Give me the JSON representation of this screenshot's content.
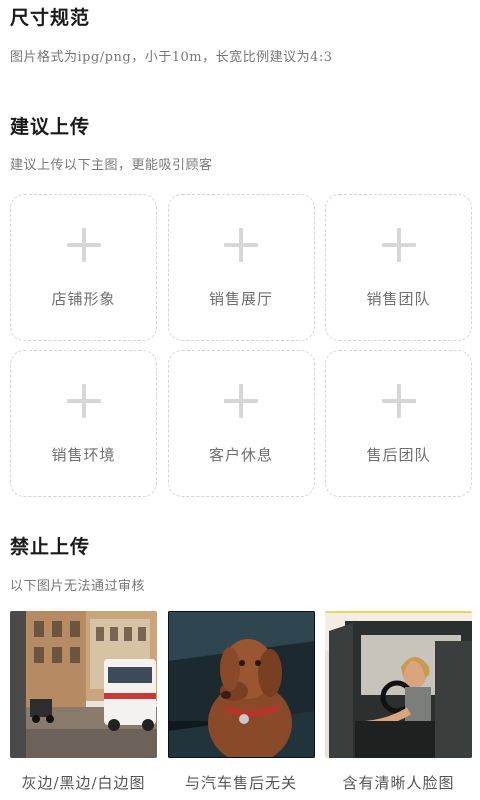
{
  "size_spec": {
    "title": "尺寸规范",
    "desc": "图片格式为ipg/png，小于10m，长宽比例建议为4:3"
  },
  "suggest": {
    "title": "建议上传",
    "desc": "建议上传以下主图，更能吸引顾客",
    "slots": [
      {
        "label": "店铺形象"
      },
      {
        "label": "销售展厅"
      },
      {
        "label": "销售团队"
      },
      {
        "label": "销售环境"
      },
      {
        "label": "客户休息"
      },
      {
        "label": "售后团队"
      }
    ]
  },
  "forbid": {
    "title": "禁止上传",
    "desc": "以下图片无法通过审核",
    "items": [
      {
        "label": "灰边/黑边/白边图",
        "image": "street-van-photo"
      },
      {
        "label": "与汽车售后无关",
        "image": "dog-in-car-photo"
      },
      {
        "label": "含有清晰人脸图",
        "image": "man-in-car-photo"
      }
    ]
  }
}
